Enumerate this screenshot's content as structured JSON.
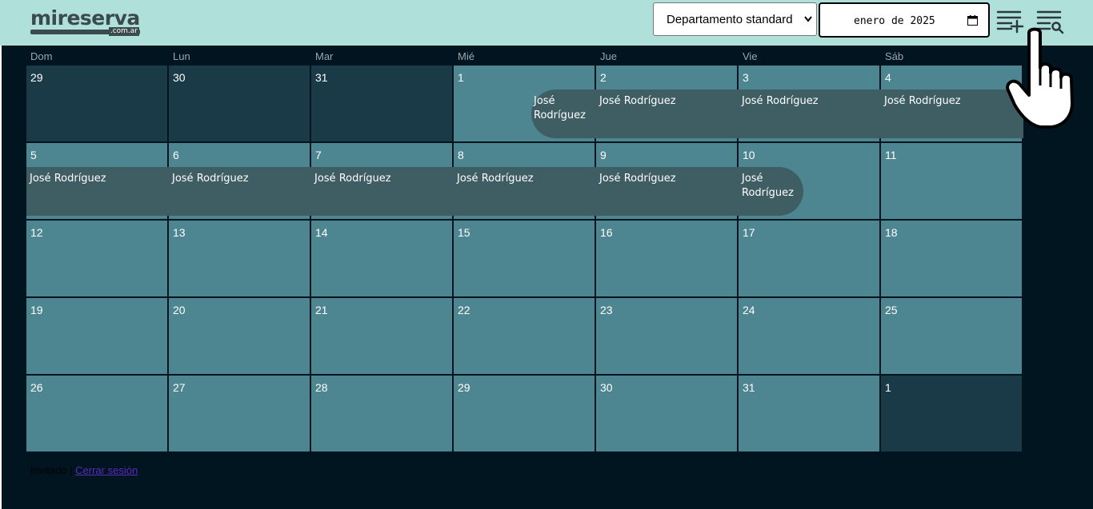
{
  "header": {
    "logo_text": "mireserva",
    "logo_sub": ".com.ar",
    "property_select": "Departamento standard",
    "month_input": "enero de 2025",
    "icons": [
      "add-list-icon",
      "search-list-icon"
    ]
  },
  "calendar": {
    "weekdays": [
      "Dom",
      "Lun",
      "Mar",
      "Mié",
      "Jue",
      "Vie",
      "Sáb"
    ],
    "weeks": [
      [
        {
          "d": "29",
          "other": true
        },
        {
          "d": "30",
          "other": true
        },
        {
          "d": "31",
          "other": true
        },
        {
          "d": "1"
        },
        {
          "d": "2"
        },
        {
          "d": "3"
        },
        {
          "d": "4"
        }
      ],
      [
        {
          "d": "5"
        },
        {
          "d": "6"
        },
        {
          "d": "7"
        },
        {
          "d": "8"
        },
        {
          "d": "9"
        },
        {
          "d": "10"
        },
        {
          "d": "11"
        }
      ],
      [
        {
          "d": "12"
        },
        {
          "d": "13"
        },
        {
          "d": "14"
        },
        {
          "d": "15"
        },
        {
          "d": "16"
        },
        {
          "d": "17"
        },
        {
          "d": "18"
        }
      ],
      [
        {
          "d": "19"
        },
        {
          "d": "20"
        },
        {
          "d": "21"
        },
        {
          "d": "22"
        },
        {
          "d": "23"
        },
        {
          "d": "24"
        },
        {
          "d": "25"
        }
      ],
      [
        {
          "d": "26"
        },
        {
          "d": "27"
        },
        {
          "d": "28"
        },
        {
          "d": "29"
        },
        {
          "d": "30"
        },
        {
          "d": "31"
        },
        {
          "d": "1",
          "other": true
        }
      ]
    ],
    "events": [
      {
        "week": 0,
        "col": 3,
        "label": "José Rodríguez",
        "start": true,
        "end": false
      },
      {
        "week": 0,
        "col": 4,
        "label": "José Rodríguez",
        "start": false,
        "end": false
      },
      {
        "week": 0,
        "col": 5,
        "label": "José Rodríguez",
        "start": false,
        "end": false
      },
      {
        "week": 0,
        "col": 6,
        "label": "José Rodríguez",
        "start": false,
        "end": false
      },
      {
        "week": 1,
        "col": 0,
        "label": "José Rodríguez",
        "start": false,
        "end": false
      },
      {
        "week": 1,
        "col": 1,
        "label": "José Rodríguez",
        "start": false,
        "end": false
      },
      {
        "week": 1,
        "col": 2,
        "label": "José Rodríguez",
        "start": false,
        "end": false
      },
      {
        "week": 1,
        "col": 3,
        "label": "José Rodríguez",
        "start": false,
        "end": false
      },
      {
        "week": 1,
        "col": 4,
        "label": "José Rodríguez",
        "start": false,
        "end": false
      },
      {
        "week": 1,
        "col": 5,
        "label": "José Rodríguez",
        "start": false,
        "end": true
      }
    ]
  },
  "footer": {
    "user": "Invitado |",
    "logout": "Cerrar sesión"
  },
  "colors": {
    "header_bg": "#b0e0da",
    "app_bg": "#001520",
    "cell_bg": "#4d8590",
    "cell_other_bg": "#1b3a47",
    "event_bg": "#3f5e63"
  }
}
